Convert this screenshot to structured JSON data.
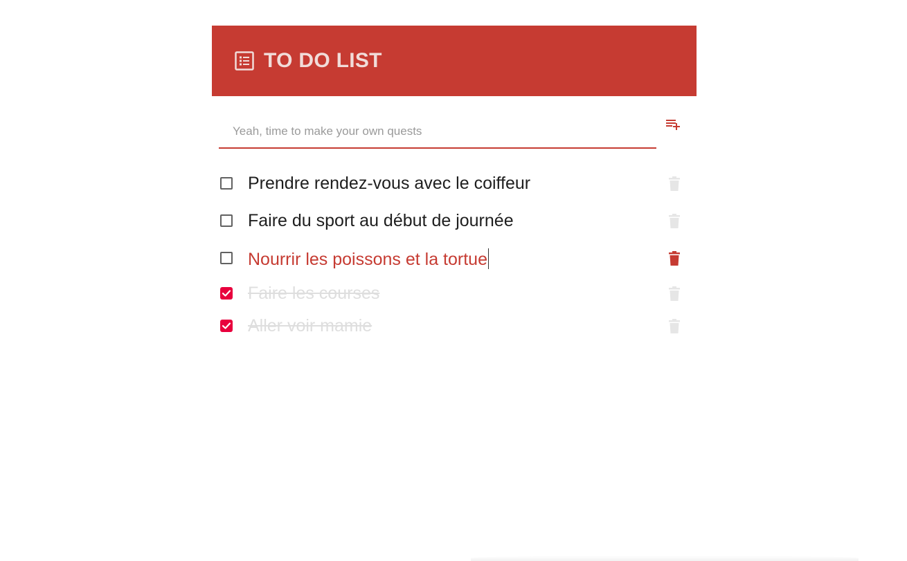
{
  "header": {
    "title": "TO DO LIST",
    "icon": "list-alt-icon",
    "background_color": "#c63b32"
  },
  "new_quest": {
    "placeholder": "Yeah, time to make your own quests",
    "value": "",
    "add_icon": "playlist-add-icon"
  },
  "tasks": [
    {
      "label": "Prendre rendez-vous avec le coiffeur",
      "completed": false,
      "editing": false
    },
    {
      "label": "Faire du sport au début de journée",
      "completed": false,
      "editing": false
    },
    {
      "label": "Nourrir les poissons et la tortue",
      "completed": false,
      "editing": true
    },
    {
      "label": "Faire les courses",
      "completed": true,
      "editing": false
    },
    {
      "label": "Aller voir mamie",
      "completed": true,
      "editing": false
    }
  ],
  "colors": {
    "accent": "#c63b32",
    "checked": "#e8003d",
    "delete_active": "#c63b32",
    "delete_inactive": "#e6e6e6"
  }
}
